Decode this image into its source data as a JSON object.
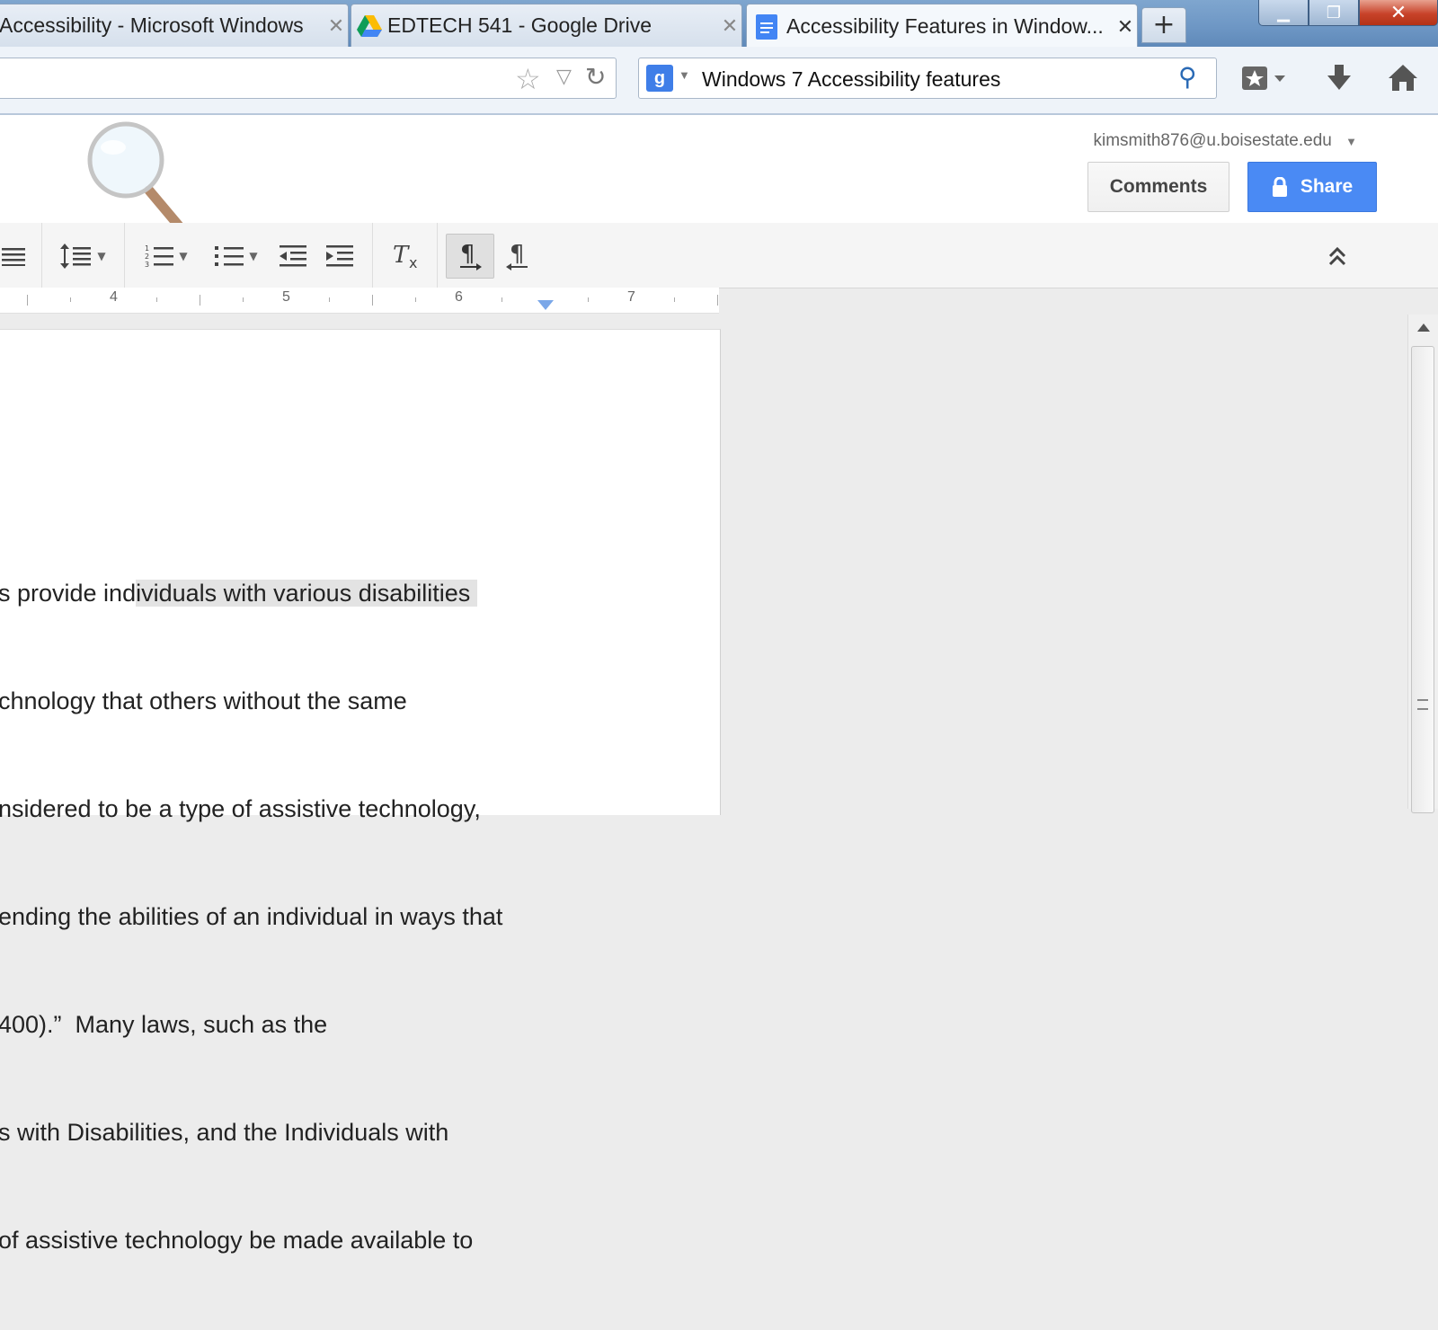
{
  "browser": {
    "tabs": [
      {
        "title": "Accessibility - Microsoft Windows",
        "icon": "windows-page-icon"
      },
      {
        "title": "EDTECH 541 - Google Drive",
        "icon": "google-drive-icon"
      },
      {
        "title": "Accessibility Features in Window...",
        "icon": "google-docs-icon"
      }
    ],
    "new_tab_label": "+",
    "search": {
      "engine": "Google",
      "query": "Windows 7 Accessibility features"
    }
  },
  "docs": {
    "account_email": "kimsmith876@u.boisestate.edu",
    "comments_label": "Comments",
    "share_label": "Share",
    "share_color": "#4a8af4"
  },
  "ruler": {
    "numbers": [
      "4",
      "5",
      "6",
      "7"
    ]
  },
  "document": {
    "lines": [
      {
        "pre": "s provide ind",
        "hl": "ividuals with various disabilities "
      },
      {
        "pre": "chnology that others without the same",
        "hl": ""
      },
      {
        "pre": "nsidered to be a type of assistive technology,",
        "hl": ""
      },
      {
        "pre": "ending the abilities of an individual in ways that",
        "hl": ""
      },
      {
        "pre": "400).”  Many laws, such as the",
        "hl": ""
      },
      {
        "pre": "s with Disabilities, and the Individuals with",
        "hl": ""
      },
      {
        "pre": "of assistive technology be made available to",
        "hl": ""
      }
    ]
  }
}
